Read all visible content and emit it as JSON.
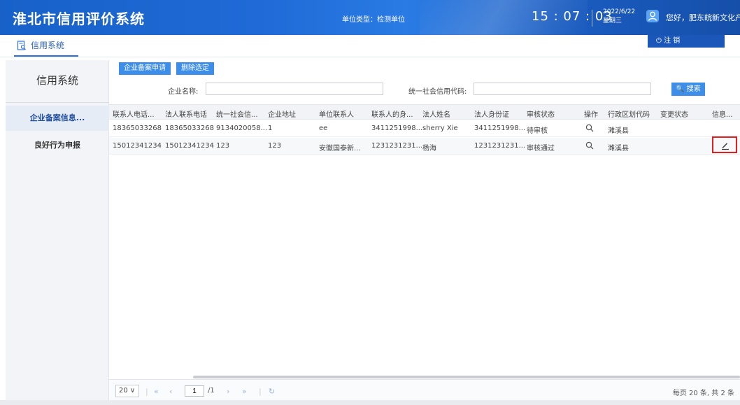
{
  "header": {
    "brand": "淮北市信用评价系统",
    "unit_type": "单位类型：检测单位",
    "time": "15 : 07 : 03",
    "date": "2022/6/22",
    "weekday": "星期三",
    "greeting": "您好，肥东皖新文化产...",
    "logout_label": "⏻ 注 销"
  },
  "subbar": {
    "tab_label": "信用系统"
  },
  "sidebar": {
    "title": "信用系统",
    "items": [
      {
        "label": "企业备案信息..."
      },
      {
        "label": "良好行为申报"
      }
    ]
  },
  "toolbar": {
    "apply_label": "企业备案申请",
    "delete_label": "删除选定"
  },
  "filters": {
    "company_name_label": "企业名称:",
    "company_name_value": "",
    "credit_code_label": "统一社会信用代码:",
    "credit_code_value": "",
    "search_label": "🔍 搜索"
  },
  "table": {
    "columns": [
      "联系人电话...",
      "法人联系电话",
      "统一社会信...",
      "企业地址",
      "单位联系人",
      "联系人的身...",
      "法人姓名",
      "法人身份证",
      "审核状态",
      "操作",
      "行政区划代码",
      "变更状态",
      "信息..."
    ],
    "rows": [
      [
        "18365033268",
        "18365033268",
        "9134020058...",
        "1",
        "ee",
        "3411251998...",
        "sherry Xie",
        "3411251998...",
        "待审核",
        "",
        "濉溪县",
        "",
        ""
      ],
      [
        "15012341234",
        "15012341234",
        "123",
        "123",
        "安徽国泰新...",
        "1231231231...",
        "杨海",
        "1231231231...",
        "审核通过",
        "",
        "濉溪县",
        "",
        ""
      ]
    ]
  },
  "pager": {
    "page_size": "20 ∨",
    "current_page": "1",
    "total_pages": "/1",
    "summary": "每页 20 条, 共 2 条"
  },
  "colors": {
    "header_blue": "#1f6ad6",
    "button_blue": "#3d8ee8",
    "highlight_red": "#e02020"
  }
}
